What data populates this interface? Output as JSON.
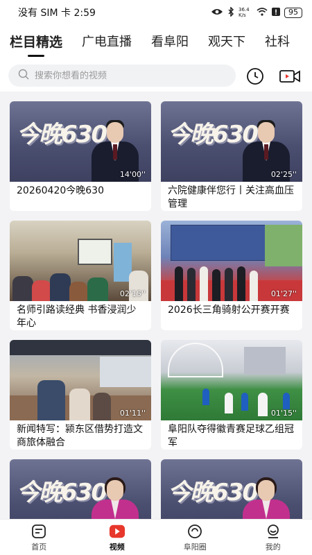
{
  "status_bar": {
    "left_text": "没有 SIM 卡 2:59",
    "network_text": "36.4 K/s",
    "battery": "95"
  },
  "top_tabs": [
    {
      "label": "栏目精选",
      "active": true
    },
    {
      "label": "广电直播",
      "active": false
    },
    {
      "label": "看阜阳",
      "active": false
    },
    {
      "label": "观天下",
      "active": false
    },
    {
      "label": "社科",
      "active": false
    }
  ],
  "search": {
    "placeholder": "搜索你想看的视频",
    "icons": [
      "search-icon",
      "history-clock-icon",
      "video-camera-icon"
    ]
  },
  "videos": [
    {
      "title": "20260420今晚630",
      "duration": "14'00''",
      "thumb": "news-male"
    },
    {
      "title": "六院健康伴您行丨关注高血压管理",
      "duration": "02'25''",
      "thumb": "news-male"
    },
    {
      "title": "名师引路读经典 书香浸润少年心",
      "duration": "02'15''",
      "thumb": "classroom"
    },
    {
      "title": "2026长三角骑射公开赛开赛",
      "duration": "01'27''",
      "thumb": "ceremony"
    },
    {
      "title": "新闻特写：颍东区借势打造文商旅体融合",
      "duration": "01'11''",
      "thumb": "market"
    },
    {
      "title": "阜阳队夺得徽青赛足球乙组冠军",
      "duration": "01'15''",
      "thumb": "football"
    },
    {
      "title": "",
      "duration": "",
      "thumb": "news-female"
    },
    {
      "title": "",
      "duration": "",
      "thumb": "news-female"
    }
  ],
  "thumbnail_logo_text": "今晚630",
  "bottom_nav": [
    {
      "label": "首页",
      "icon": "home-icon",
      "active": false
    },
    {
      "label": "视频",
      "icon": "video-play-icon",
      "active": true
    },
    {
      "label": "阜阳圈",
      "icon": "circle-icon",
      "active": false
    },
    {
      "label": "我的",
      "icon": "profile-icon",
      "active": false
    }
  ],
  "colors": {
    "accent_red": "#e8372c",
    "text_primary": "#111111",
    "background": "#f3f3f5"
  }
}
